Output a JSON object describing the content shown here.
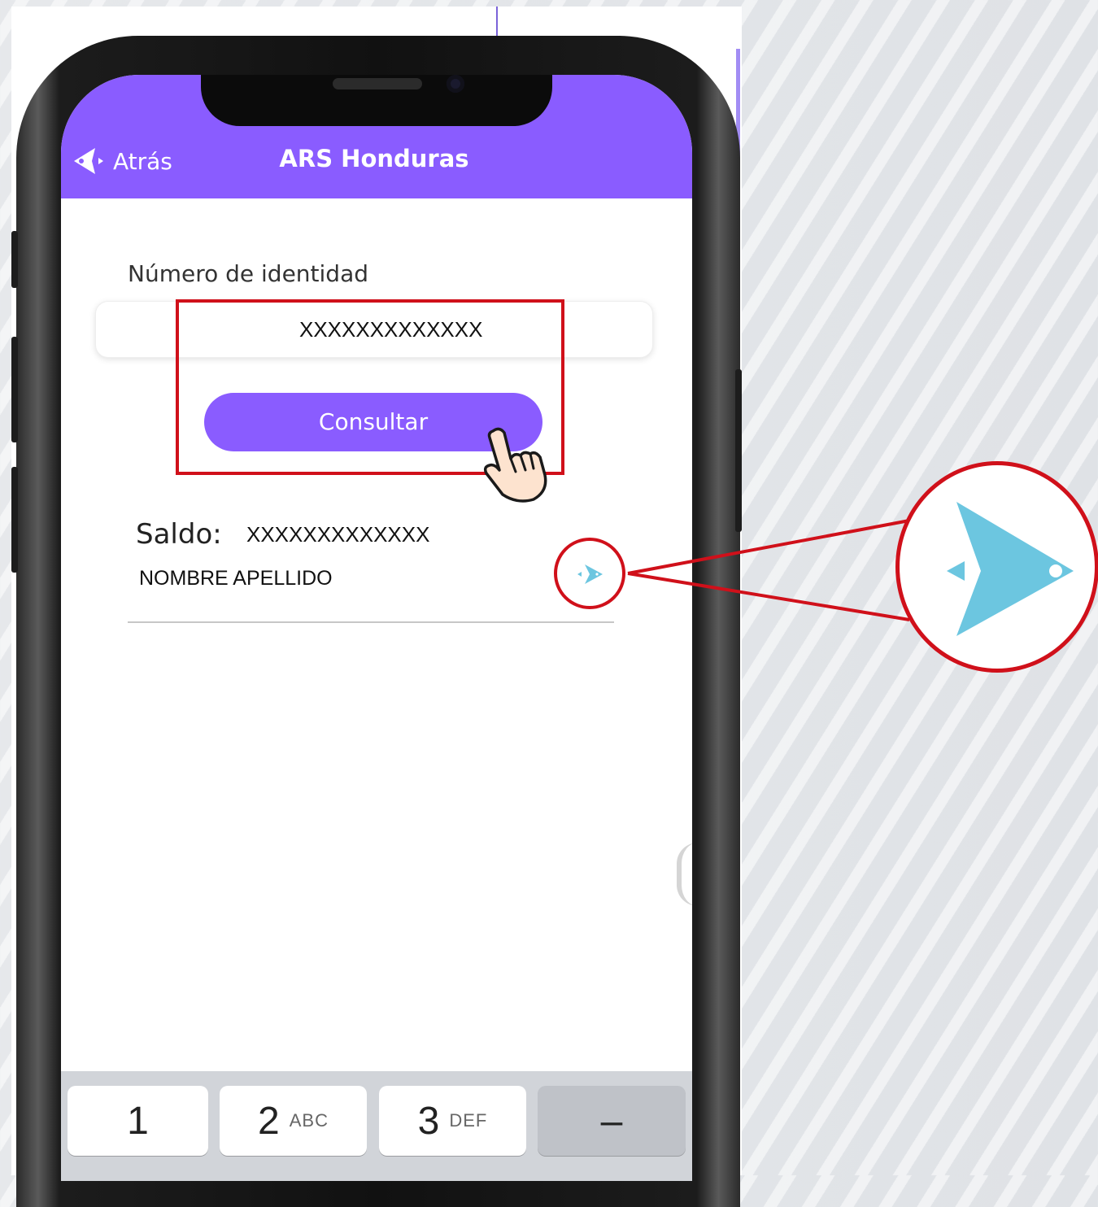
{
  "header": {
    "back_label": "Atrás",
    "title": "ARS Honduras"
  },
  "form": {
    "id_label": "Número de identidad",
    "id_value": "XXXXXXXXXXXXX",
    "submit_label": "Consultar"
  },
  "result": {
    "saldo_label": "Saldo:",
    "saldo_value": "XXXXXXXXXXXXX",
    "name": "NOMBRE APELLIDO"
  },
  "keypad": {
    "keys": [
      {
        "num": "1",
        "letters": ""
      },
      {
        "num": "2",
        "letters": "ABC"
      },
      {
        "num": "3",
        "letters": "DEF"
      },
      {
        "num": "–",
        "letters": ""
      }
    ]
  },
  "colors": {
    "brand_purple": "#8a5cff",
    "annotation_red": "#d0101a",
    "icon_blue": "#6cc6e0"
  },
  "icons": {
    "back": "back-arrow-icon",
    "detail": "arrow-fish-icon",
    "pointer": "hand-pointer-icon"
  }
}
